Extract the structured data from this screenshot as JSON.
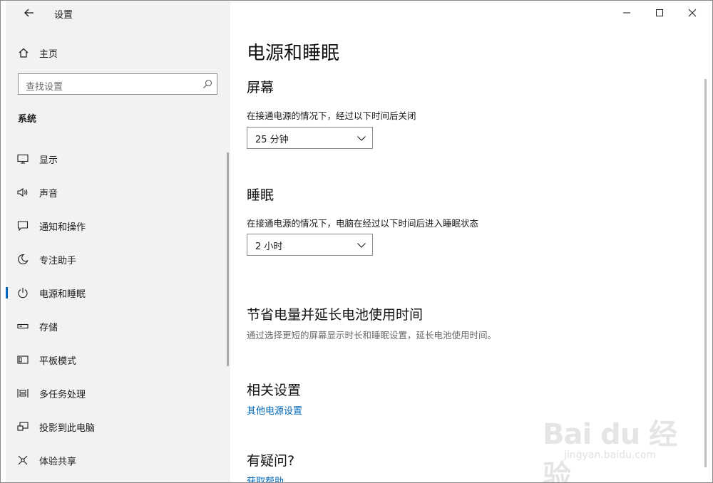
{
  "window": {
    "title": "设置",
    "controls": {
      "minimize": "minimize-icon",
      "maximize": "maximize-icon",
      "close": "close-icon"
    }
  },
  "sidebar": {
    "home_label": "主页",
    "search_placeholder": "查找设置",
    "section_label": "系统",
    "items": [
      {
        "label": "显示",
        "icon": "monitor-icon"
      },
      {
        "label": "声音",
        "icon": "speaker-icon"
      },
      {
        "label": "通知和操作",
        "icon": "notification-icon"
      },
      {
        "label": "专注助手",
        "icon": "moon-icon"
      },
      {
        "label": "电源和睡眠",
        "icon": "power-icon",
        "selected": true
      },
      {
        "label": "存储",
        "icon": "storage-icon"
      },
      {
        "label": "平板模式",
        "icon": "tablet-icon"
      },
      {
        "label": "多任务处理",
        "icon": "multitask-icon"
      },
      {
        "label": "投影到此电脑",
        "icon": "project-icon"
      },
      {
        "label": "体验共享",
        "icon": "share-icon"
      }
    ]
  },
  "main": {
    "title": "电源和睡眠",
    "screen": {
      "heading": "屏幕",
      "description": "在接通电源的情况下，经过以下时间后关闭",
      "value": "25 分钟"
    },
    "sleep": {
      "heading": "睡眠",
      "description": "在接通电源的情况下，电脑在经过以下时间后进入睡眠状态",
      "value": "2 小时"
    },
    "battery": {
      "heading": "节省电量并延长电池使用时间",
      "description": "通过选择更短的屏幕显示时长和睡眠设置，延长电池使用时间。"
    },
    "related": {
      "heading": "相关设置",
      "link": "其他电源设置"
    },
    "help": {
      "heading": "有疑问?",
      "link": "获取帮助"
    }
  },
  "watermark": {
    "brand": "Bai du 经验",
    "url": "jingyan.baidu.com"
  },
  "colors": {
    "accent": "#0067c0",
    "link": "#0067b8",
    "sidebar_bg": "#f2f2f2"
  }
}
